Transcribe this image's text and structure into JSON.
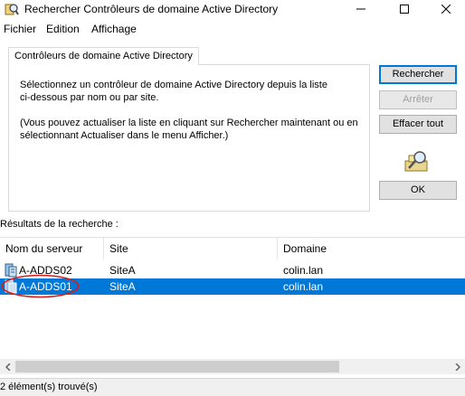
{
  "window": {
    "title": "Rechercher Contrôleurs de domaine Active Directory",
    "controls": [
      "minimize-icon",
      "maximize-icon",
      "close-icon"
    ]
  },
  "menu": [
    "Fichier",
    "Edition",
    "Affichage"
  ],
  "tab": {
    "label": "Contrôleurs de domaine Active Directory",
    "line1": "Sélectionnez un contrôleur de domaine Active Directory depuis la liste",
    "line2": "ci-dessous par nom ou par site.",
    "line3": "(Vous pouvez actualiser la liste en cliquant sur Rechercher maintenant ou en",
    "line4": "sélectionnant Actualiser dans le menu Afficher.)"
  },
  "buttons": {
    "search": "Rechercher",
    "stop": "Arrêter",
    "clear": "Effacer tout",
    "ok": "OK"
  },
  "results": {
    "label": "Résultats de la recherche :",
    "columns": [
      "Nom du serveur",
      "Site",
      "Domaine"
    ],
    "rows": [
      {
        "name": "A-ADDS02",
        "site": "SiteA",
        "domain": "colin.lan",
        "selected": false
      },
      {
        "name": "A-ADDS01",
        "site": "SiteA",
        "domain": "colin.lan",
        "selected": true
      }
    ]
  },
  "status": "2 élément(s) trouvé(s)",
  "colors": {
    "selection": "#0078d7",
    "annotation": "#d91a1a"
  }
}
